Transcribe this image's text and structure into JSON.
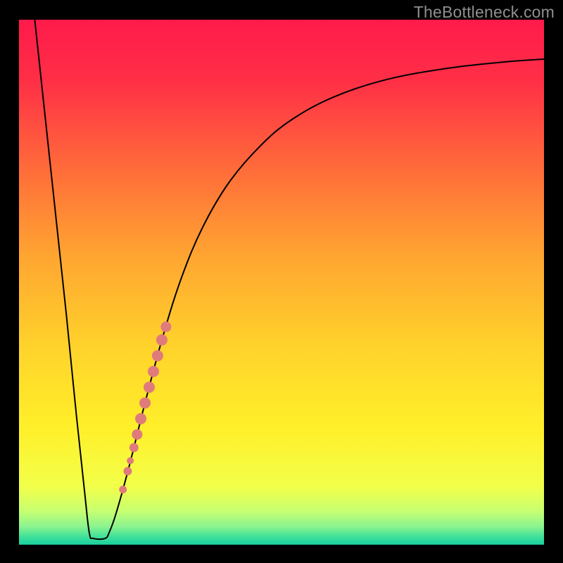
{
  "watermark": "TheBottleneck.com",
  "chart_data": {
    "type": "line",
    "title": "",
    "xlabel": "",
    "ylabel": "",
    "xlim": [
      0,
      100
    ],
    "ylim": [
      0,
      100
    ],
    "background_gradient": {
      "stops": [
        {
          "offset": 0.0,
          "color": "#ff1a4b"
        },
        {
          "offset": 0.12,
          "color": "#ff3046"
        },
        {
          "offset": 0.28,
          "color": "#ff6a3a"
        },
        {
          "offset": 0.45,
          "color": "#ffa531"
        },
        {
          "offset": 0.62,
          "color": "#ffd22b"
        },
        {
          "offset": 0.78,
          "color": "#fff02a"
        },
        {
          "offset": 0.89,
          "color": "#f2ff4a"
        },
        {
          "offset": 0.935,
          "color": "#c8ff70"
        },
        {
          "offset": 0.965,
          "color": "#8cf48e"
        },
        {
          "offset": 0.985,
          "color": "#3fe09a"
        },
        {
          "offset": 1.0,
          "color": "#18cf9d"
        }
      ]
    },
    "series": [
      {
        "name": "curve",
        "type": "line",
        "color": "#000000",
        "points": [
          {
            "x": 3.0,
            "y": 100.0
          },
          {
            "x": 6.0,
            "y": 72.0
          },
          {
            "x": 9.0,
            "y": 44.0
          },
          {
            "x": 11.0,
            "y": 24.0
          },
          {
            "x": 12.5,
            "y": 10.0
          },
          {
            "x": 13.4,
            "y": 2.2
          },
          {
            "x": 14.2,
            "y": 1.2
          },
          {
            "x": 16.4,
            "y": 1.2
          },
          {
            "x": 17.2,
            "y": 2.4
          },
          {
            "x": 18.5,
            "y": 6.0
          },
          {
            "x": 21.0,
            "y": 15.0
          },
          {
            "x": 24.0,
            "y": 27.0
          },
          {
            "x": 27.5,
            "y": 40.0
          },
          {
            "x": 31.0,
            "y": 51.0
          },
          {
            "x": 35.0,
            "y": 60.5
          },
          {
            "x": 40.0,
            "y": 69.0
          },
          {
            "x": 46.0,
            "y": 76.0
          },
          {
            "x": 52.0,
            "y": 81.0
          },
          {
            "x": 60.0,
            "y": 85.3
          },
          {
            "x": 70.0,
            "y": 88.6
          },
          {
            "x": 82.0,
            "y": 90.8
          },
          {
            "x": 93.0,
            "y": 92.0
          },
          {
            "x": 100.0,
            "y": 92.5
          }
        ]
      },
      {
        "name": "markers",
        "type": "scatter",
        "color": "#e07b7b",
        "points": [
          {
            "x": 19.8,
            "y": 10.5,
            "r": 5.5
          },
          {
            "x": 20.7,
            "y": 14.0,
            "r": 6.0
          },
          {
            "x": 21.2,
            "y": 16.0,
            "r": 5.0
          },
          {
            "x": 21.9,
            "y": 18.5,
            "r": 6.5
          },
          {
            "x": 22.5,
            "y": 21.0,
            "r": 7.5
          },
          {
            "x": 23.2,
            "y": 24.0,
            "r": 8.0
          },
          {
            "x": 24.0,
            "y": 27.0,
            "r": 8.0
          },
          {
            "x": 24.8,
            "y": 30.0,
            "r": 8.0
          },
          {
            "x": 25.6,
            "y": 33.0,
            "r": 8.0
          },
          {
            "x": 26.4,
            "y": 36.0,
            "r": 8.0
          },
          {
            "x": 27.2,
            "y": 39.0,
            "r": 8.0
          },
          {
            "x": 28.0,
            "y": 41.5,
            "r": 7.5
          }
        ]
      }
    ]
  }
}
